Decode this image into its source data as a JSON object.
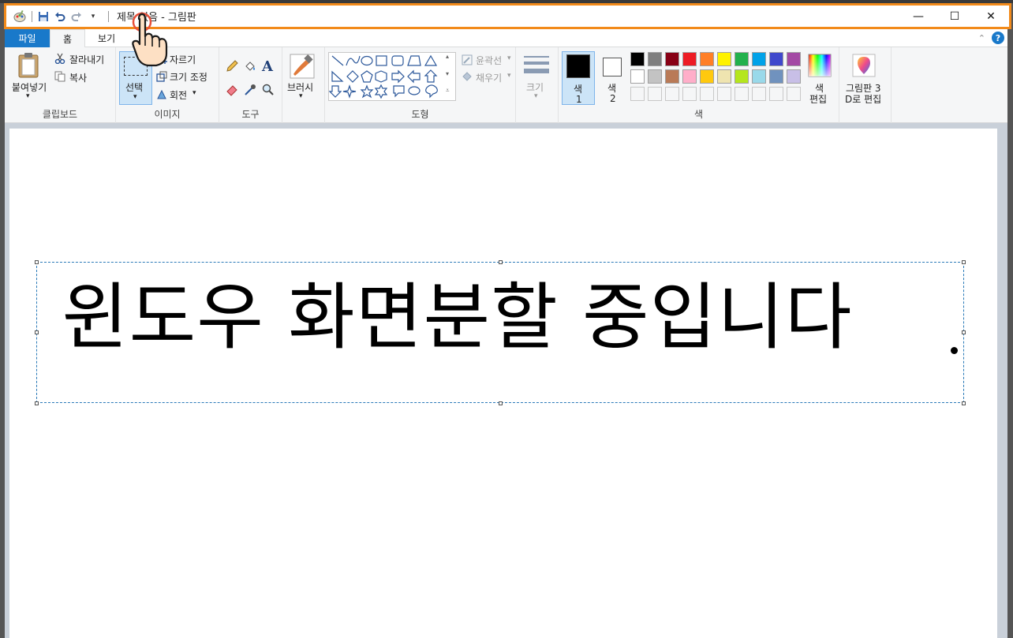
{
  "title_bar": {
    "title": "제목 없음 - 그림판",
    "minimize": "—",
    "maximize": "☐",
    "close": "✕"
  },
  "menu": {
    "tabs": [
      "파일",
      "홈",
      "보기"
    ]
  },
  "ribbon": {
    "clipboard": {
      "paste": "붙여넣기",
      "cut": "잘라내기",
      "copy": "복사",
      "label": "클립보드"
    },
    "image": {
      "select": "선택",
      "crop": "자르기",
      "resize": "크기 조정",
      "rotate": "회전",
      "label": "이미지"
    },
    "tools": {
      "label": "도구"
    },
    "brushes": {
      "label": "브러시"
    },
    "shapes": {
      "outline": "윤곽선",
      "fill": "채우기",
      "label": "도형"
    },
    "size": {
      "label": "크기"
    },
    "colors": {
      "color1": "색\n1",
      "color1_a": "색",
      "color1_b": "1",
      "color2_a": "색",
      "color2_b": "2",
      "edit_a": "색",
      "edit_b": "편집",
      "label": "색",
      "palette_row1": [
        "#000000",
        "#7f7f7f",
        "#880015",
        "#ed1c24",
        "#ff7f27",
        "#fff200",
        "#22b14c",
        "#00a2e8",
        "#3f48cc",
        "#a349a4"
      ],
      "palette_row2": [
        "#ffffff",
        "#c3c3c3",
        "#b97a57",
        "#ffaec9",
        "#ffc90e",
        "#efe4b0",
        "#b5e61d",
        "#99d9ea",
        "#7092be",
        "#c8bfe7"
      ]
    },
    "paint3d": {
      "line1": "그림판 3",
      "line2": "D로 편집"
    }
  },
  "canvas": {
    "text": "윈도우 화면분할 중입니다"
  }
}
